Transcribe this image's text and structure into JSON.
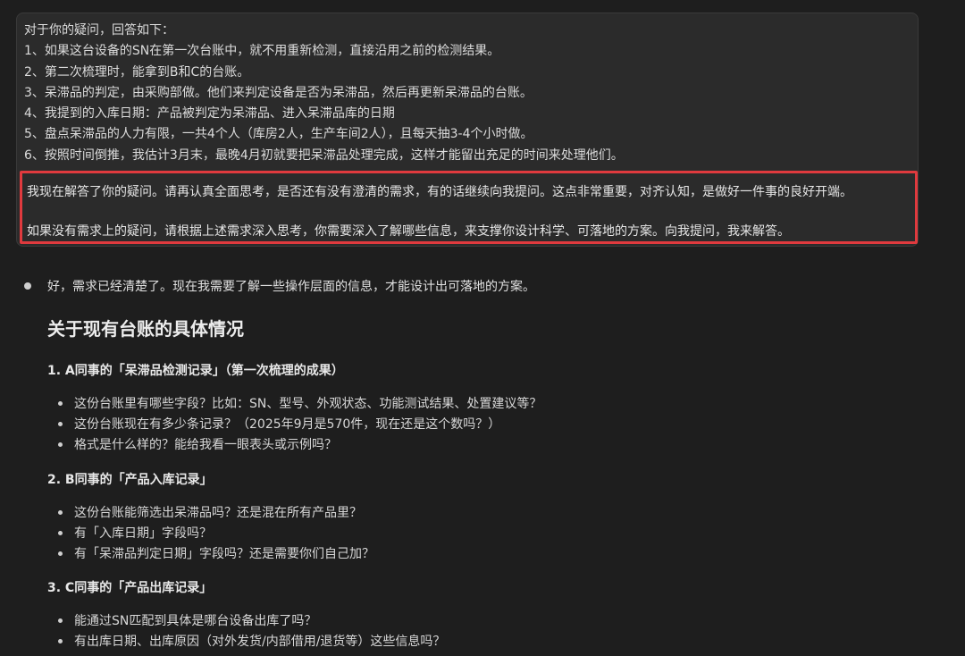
{
  "user_message": {
    "lines": [
      "对于你的疑问，回答如下：",
      "1、如果这台设备的SN在第一次台账中，就不用重新检测，直接沿用之前的检测结果。",
      "2、第二次梳理时，能拿到B和C的台账。",
      "3、呆滞品的判定，由采购部做。他们来判定设备是否为呆滞品，然后再更新呆滞品的台账。",
      "4、我提到的入库日期：产品被判定为呆滞品、进入呆滞品库的日期",
      "5、盘点呆滞品的人力有限，一共4个人（库房2人，生产车间2人），且每天抽3-4个小时做。",
      "6、按照时间倒推，我估计3月末，最晚4月初就要把呆滞品处理完成，这样才能留出充足的时间来处理他们。"
    ],
    "highlight_1": "我现在解答了你的疑问。请再认真全面思考，是否还有没有澄清的需求，有的话继续向我提问。这点非常重要，对齐认知，是做好一件事的良好开端。",
    "highlight_2": "如果没有需求上的疑问，请根据上述需求深入思考，你需要深入了解哪些信息，来支撑你设计科学、可落地的方案。向我提问，我来解答。",
    "highlight_color": "#e03a3e"
  },
  "reply": {
    "intro": "好，需求已经清楚了。现在我需要了解一些操作层面的信息，才能设计出可落地的方案。",
    "heading": "关于现有台账的具体情况",
    "sections": [
      {
        "title": "1. A同事的「呆滞品检测记录」（第一次梳理的成果）",
        "items": [
          "这份台账里有哪些字段？比如：SN、型号、外观状态、功能测试结果、处置建议等？",
          "这份台账现在有多少条记录？（2025年9月是570件，现在还是这个数吗？）",
          "格式是什么样的？能给我看一眼表头或示例吗？"
        ]
      },
      {
        "title": "2. B同事的「产品入库记录」",
        "items": [
          "这份台账能筛选出呆滞品吗？还是混在所有产品里？",
          "有「入库日期」字段吗？",
          "有「呆滞品判定日期」字段吗？还是需要你们自己加？"
        ]
      },
      {
        "title": "3. C同事的「产品出库记录」",
        "items": [
          "能通过SN匹配到具体是哪台设备出库了吗？",
          "有出库日期、出库原因（对外发货/内部借用/退货等）这些信息吗？"
        ]
      }
    ]
  }
}
